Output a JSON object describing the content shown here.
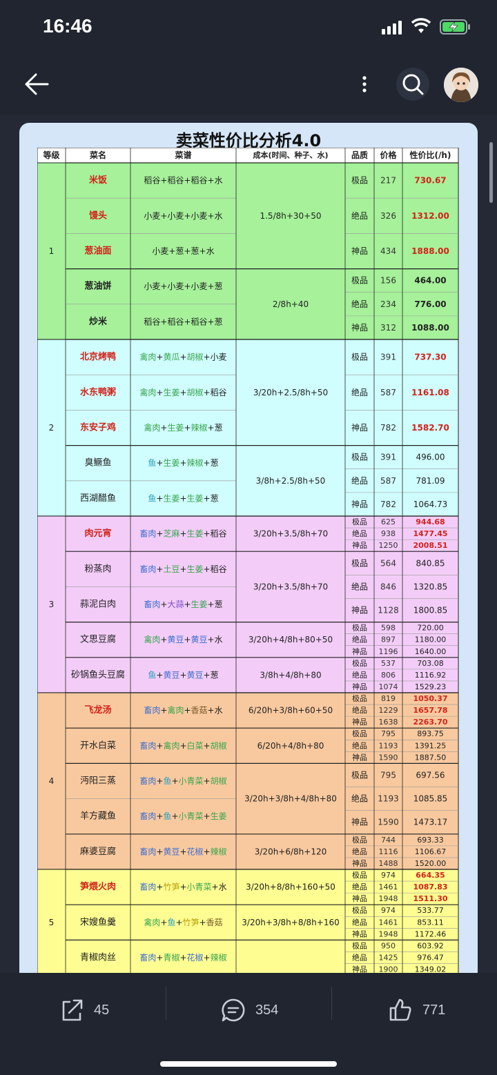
{
  "status": {
    "time": "16:46"
  },
  "nav": {
    "back_icon": "back-arrow-icon",
    "more_icon": "more-vertical-icon",
    "search_icon": "search-icon",
    "avatar_icon": "user-avatar"
  },
  "sheet": {
    "title": "卖菜性价比分析4.0",
    "headers": [
      "等级",
      "菜名",
      "菜谱",
      "成本(时间、种子、水)",
      "品质",
      "价格",
      "性价比(/h)"
    ],
    "tiers": [
      {
        "level": "1",
        "color": "#a6f19a",
        "groups": [
          {
            "cost": "1.5/8h+30+50",
            "dishes": [
              {
                "name": "米饭",
                "red": true,
                "recipe": [
                  "稻谷",
                  "稻谷",
                  "稻谷",
                  "水"
                ],
                "q": [
                  "极品"
                ],
                "p": [
                  "217"
                ],
                "v": [
                  "730.67"
                ]
              },
              {
                "name": "馒头",
                "red": true,
                "recipe": [
                  "小麦",
                  "小麦",
                  "小麦",
                  "水"
                ],
                "q": [
                  "绝品"
                ],
                "p": [
                  "326"
                ],
                "v": [
                  "1312.00"
                ]
              },
              {
                "name": "葱油面",
                "red": true,
                "recipe": [
                  "小麦",
                  "葱",
                  "葱",
                  "水"
                ],
                "q": [
                  "神品"
                ],
                "p": [
                  "434"
                ],
                "v": [
                  "1888.00"
                ]
              }
            ]
          },
          {
            "cost": "2/8h+40",
            "dishes": [
              {
                "name": "葱油饼",
                "red": false,
                "recipe": [
                  "小麦",
                  "小麦",
                  "小麦",
                  "葱"
                ],
                "q": [
                  "极品",
                  "绝品"
                ],
                "p": [
                  "156",
                  "234"
                ],
                "v": [
                  "464.00",
                  "776.00"
                ],
                "bold": true
              },
              {
                "name": "炒米",
                "red": false,
                "recipe": [
                  "稻谷",
                  "稻谷",
                  "稻谷",
                  "葱"
                ],
                "q": [
                  "神品"
                ],
                "p": [
                  "312"
                ],
                "v": [
                  "1088.00"
                ],
                "bold": true
              }
            ]
          }
        ]
      },
      {
        "level": "2",
        "color": "#d0fdfd",
        "groups": [
          {
            "cost": "3/20h+2.5/8h+50",
            "dishes": [
              {
                "name": "北京烤鸭",
                "red": true,
                "recipe": [
                  "禽肉",
                  "黄瓜",
                  "胡椒",
                  "小麦"
                ],
                "q": [
                  "极品"
                ],
                "p": [
                  "391"
                ],
                "v": [
                  "737.30"
                ]
              },
              {
                "name": "水东鸭粥",
                "red": true,
                "recipe": [
                  "禽肉",
                  "生姜",
                  "胡椒",
                  "稻谷"
                ],
                "q": [
                  "绝品"
                ],
                "p": [
                  "587"
                ],
                "v": [
                  "1161.08"
                ]
              },
              {
                "name": "东安子鸡",
                "red": true,
                "recipe": [
                  "禽肉",
                  "生姜",
                  "辣椒",
                  "葱"
                ],
                "q": [
                  "神品"
                ],
                "p": [
                  "782"
                ],
                "v": [
                  "1582.70"
                ]
              }
            ]
          },
          {
            "cost": "3/8h+2.5/8h+50",
            "dishes": [
              {
                "name": "臭鳜鱼",
                "red": false,
                "recipe": [
                  "鱼",
                  "生姜",
                  "辣椒",
                  "葱"
                ],
                "q": [
                  "极品",
                  "绝品"
                ],
                "p": [
                  "391",
                  "587"
                ],
                "v": [
                  "496.00",
                  "781.09"
                ]
              },
              {
                "name": "西湖醋鱼",
                "red": false,
                "recipe": [
                  "鱼",
                  "生姜",
                  "生姜",
                  "葱"
                ],
                "q": [
                  "神品"
                ],
                "p": [
                  "782"
                ],
                "v": [
                  "1064.73"
                ]
              }
            ]
          }
        ]
      },
      {
        "level": "3",
        "color": "#f3cdf8",
        "groups": [
          {
            "cost": "3/20h+3.5/8h+70",
            "dishes": [
              {
                "name": "肉元宵",
                "red": true,
                "recipe": [
                  "畜肉",
                  "芝麻",
                  "生姜",
                  "稻谷"
                ],
                "q": [
                  "极品",
                  "绝品",
                  "神品"
                ],
                "p": [
                  "625",
                  "938",
                  "1250"
                ],
                "v": [
                  "944.68",
                  "1477.45",
                  "2008.51"
                ]
              }
            ]
          },
          {
            "cost": "3/20h+3.5/8h+70",
            "dishes": [
              {
                "name": "粉蒸肉",
                "red": false,
                "recipe": [
                  "畜肉",
                  "土豆",
                  "生姜",
                  "稻谷"
                ],
                "q": [
                  "极品",
                  "绝品"
                ],
                "p": [
                  "564",
                  "846"
                ],
                "v": [
                  "840.85",
                  "1320.85"
                ]
              },
              {
                "name": "蒜泥白肉",
                "red": false,
                "recipe": [
                  "畜肉",
                  "大蒜",
                  "生姜",
                  "葱"
                ],
                "q": [
                  "神品"
                ],
                "p": [
                  "1128"
                ],
                "v": [
                  "1800.85"
                ]
              }
            ]
          },
          {
            "cost": "3/20h+4/8h+80+50",
            "dishes": [
              {
                "name": "文思豆腐",
                "red": false,
                "recipe": [
                  "禽肉",
                  "黄豆",
                  "黄豆",
                  "水"
                ],
                "q": [
                  "极品",
                  "绝品",
                  "神品"
                ],
                "p": [
                  "598",
                  "897",
                  "1196"
                ],
                "v": [
                  "720.00",
                  "1180.00",
                  "1640.00"
                ]
              }
            ]
          },
          {
            "cost": "3/8h+4/8h+80",
            "dishes": [
              {
                "name": "砂锅鱼头豆腐",
                "red": false,
                "recipe": [
                  "鱼",
                  "黄豆",
                  "黄豆",
                  "葱"
                ],
                "q": [
                  "极品",
                  "绝品",
                  "神品"
                ],
                "p": [
                  "537",
                  "806",
                  "1074"
                ],
                "v": [
                  "703.08",
                  "1116.92",
                  "1529.23"
                ]
              }
            ]
          }
        ]
      },
      {
        "level": "4",
        "color": "#f8c99f",
        "groups": [
          {
            "cost": "6/20h+3/8h+60+50",
            "dishes": [
              {
                "name": "飞龙汤",
                "red": true,
                "recipe": [
                  "畜肉",
                  "禽肉",
                  "香菇",
                  "水"
                ],
                "q": [
                  "极品",
                  "绝品",
                  "神品"
                ],
                "p": [
                  "819",
                  "1229",
                  "1638"
                ],
                "v": [
                  "1050.37",
                  "1657.78",
                  "2263.70"
                ]
              }
            ]
          },
          {
            "cost": "6/20h+4/8h+80",
            "dishes": [
              {
                "name": "开水白菜",
                "red": false,
                "recipe": [
                  "畜肉",
                  "禽肉",
                  "白菜",
                  "胡椒"
                ],
                "q": [
                  "极品",
                  "绝品",
                  "神品"
                ],
                "p": [
                  "795",
                  "1193",
                  "1590"
                ],
                "v": [
                  "893.75",
                  "1391.25",
                  "1887.50"
                ]
              }
            ]
          },
          {
            "cost": "3/20h+3/8h+4/8h+80",
            "dishes": [
              {
                "name": "沔阳三蒸",
                "red": false,
                "recipe": [
                  "畜肉",
                  "鱼",
                  "小青菜",
                  "胡椒"
                ],
                "q": [
                  "极品",
                  "绝品"
                ],
                "p": [
                  "795",
                  "1193"
                ],
                "v": [
                  "697.56",
                  "1085.85"
                ]
              },
              {
                "name": "羊方藏鱼",
                "red": false,
                "recipe": [
                  "畜肉",
                  "鱼",
                  "小青菜",
                  "生姜"
                ],
                "q": [
                  "神品"
                ],
                "p": [
                  "1590"
                ],
                "v": [
                  "1473.17"
                ]
              }
            ]
          },
          {
            "cost": "3/20h+6/8h+120",
            "dishes": [
              {
                "name": "麻婆豆腐",
                "red": false,
                "recipe": [
                  "畜肉",
                  "黄豆",
                  "花椒",
                  "辣椒"
                ],
                "q": [
                  "极品",
                  "绝品",
                  "神品"
                ],
                "p": [
                  "744",
                  "1116",
                  "1488"
                ],
                "v": [
                  "693.33",
                  "1106.67",
                  "1520.00"
                ]
              }
            ]
          }
        ]
      },
      {
        "level": "5",
        "color": "#fdfd92",
        "groups": [
          {
            "cost": "3/20h+8/8h+160+50",
            "dishes": [
              {
                "name": "笋煨火肉",
                "red": true,
                "recipe": [
                  "畜肉",
                  "竹笋",
                  "小青菜",
                  "水"
                ],
                "q": [
                  "极品",
                  "绝品",
                  "神品"
                ],
                "p": [
                  "974",
                  "1461",
                  "1948"
                ],
                "v": [
                  "664.35",
                  "1087.83",
                  "1511.30"
                ]
              }
            ]
          },
          {
            "cost": "3/20h+3/8h+8/8h+160",
            "dishes": [
              {
                "name": "宋嫂鱼羹",
                "red": false,
                "recipe": [
                  "禽肉",
                  "鱼",
                  "竹笋",
                  "香菇"
                ],
                "q": [
                  "极品",
                  "绝品",
                  "神品"
                ],
                "p": [
                  "974",
                  "1461",
                  "1948"
                ],
                "v": [
                  "533.77",
                  "853.11",
                  "1172.46"
                ]
              }
            ]
          },
          {
            "cost": "",
            "dishes": [
              {
                "name": "青椒肉丝",
                "red": false,
                "recipe": [
                  "畜肉",
                  "青椒",
                  "花椒",
                  "辣椒"
                ],
                "q": [
                  "极品",
                  "绝品",
                  "神品"
                ],
                "p": [
                  "950",
                  "1425",
                  "1900"
                ],
                "v": [
                  "603.92",
                  "976.47",
                  "1349.02"
                ]
              }
            ]
          }
        ]
      }
    ],
    "ingredient_colors": {
      "禽肉": "#3aa64e",
      "畜肉": "#3f6fd0",
      "鱼": "#2aa0c0",
      "黄瓜": "#3aa64e",
      "胡椒": "#3aa64e",
      "生姜": "#3aa64e",
      "辣椒": "#3aa64e",
      "芝麻": "#3aa64e",
      "土豆": "#3aa64e",
      "大蒜": "#7b49c8",
      "黄豆": "#3f6fd0",
      "香菇": "#7a5a2a",
      "白菜": "#3aa64e",
      "小青菜": "#3aa64e",
      "花椒": "#3f6fd0",
      "竹笋": "#b8a000",
      "青椒": "#3aa64e"
    }
  },
  "actions": {
    "share_count": "45",
    "comment_count": "354",
    "like_count": "771"
  }
}
